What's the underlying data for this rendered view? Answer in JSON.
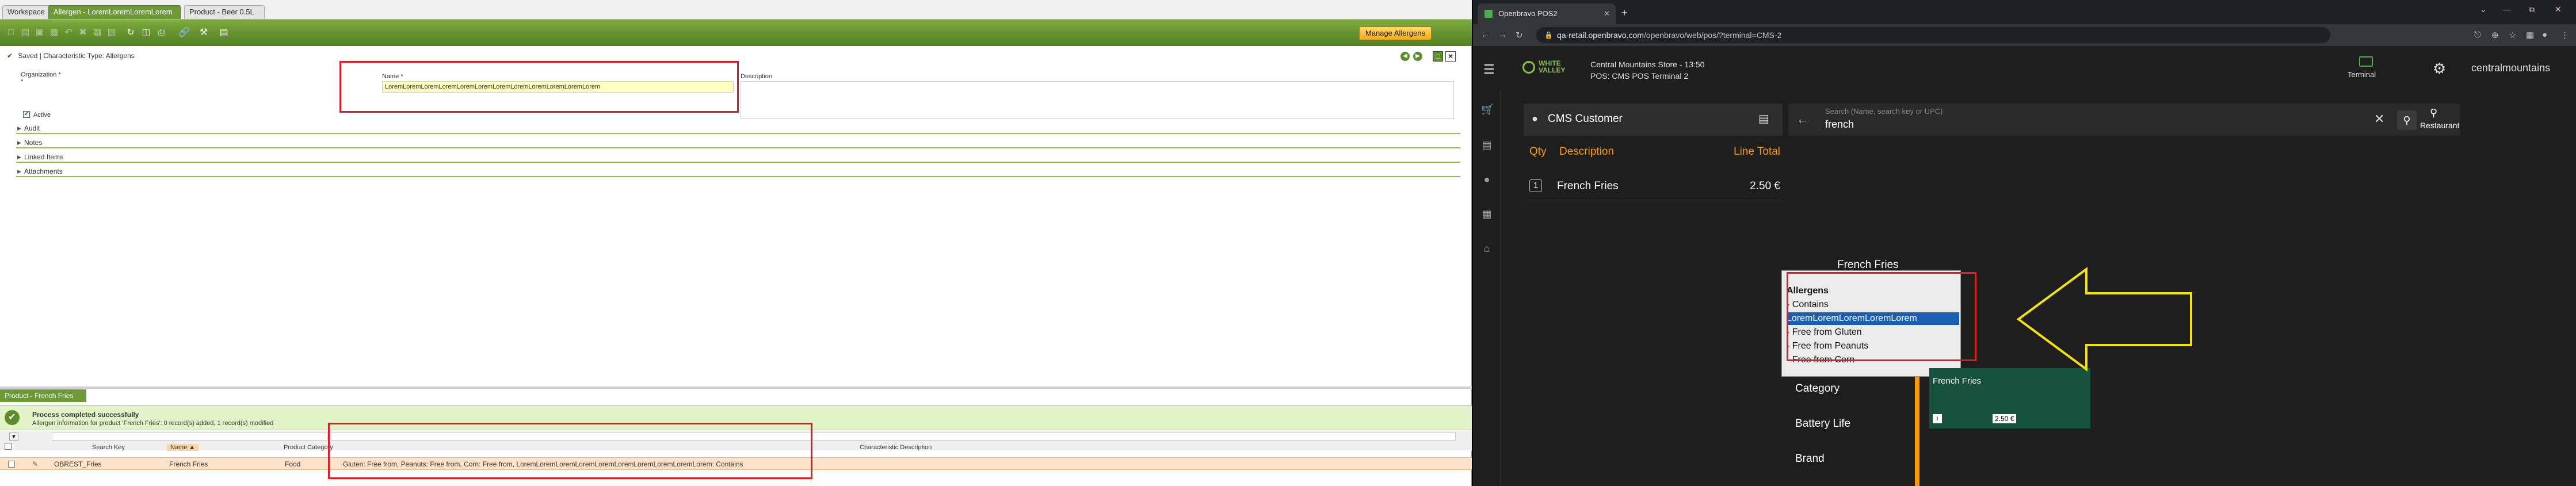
{
  "left": {
    "tabs": [
      {
        "label": "Workspace"
      },
      {
        "label": "Allergen - LoremLoremLoremLorem"
      },
      {
        "label": "Product - Beer 0.5L"
      }
    ],
    "manage_button": "Manage Allergens",
    "status": {
      "saved": "Saved",
      "separator": "|",
      "characteristic": "Characteristic Type: Allergens"
    },
    "form": {
      "organization_label": "Organization *",
      "name_label": "Name *",
      "name_value": "LoremLoremLoremLoremLoremLoremLoremLoremLoremLoremLoremLorem",
      "description_label": "Description",
      "active_label": "Active"
    },
    "sections": [
      "Audit",
      "Notes",
      "Linked Items",
      "Attachments"
    ],
    "bottom_tab": "Product - French Fries",
    "process": {
      "title": "Process completed successfully",
      "message": "Allergen information for product 'French Fries': 0 record(s) added, 1 record(s) modified"
    },
    "grid": {
      "headers": [
        "Search Key",
        "Name ▲",
        "Product Category",
        "Characteristic Description"
      ],
      "row": {
        "search_key": "OBREST_Fries",
        "name": "French Fries",
        "category": "Food",
        "characteristic": "Gluten: Free from, Peanuts: Free from, Corn: Free from, LoremLoremLoremLoremLoremLoremLoremLoremLoremLorem: Contains"
      }
    }
  },
  "right": {
    "browser_tab": "Openbravo POS2",
    "url_host": "qa-retail.openbravo.com",
    "url_path": "/openbravo/web/pos/?terminal=CMS-2",
    "brand_line1": "WHITE",
    "brand_line2": "VALLEY",
    "store": "Central Mountains Store - 13:50",
    "pos": "POS: CMS POS Terminal 2",
    "terminal_label": "Terminal",
    "user": "centralmountains",
    "customer": "CMS Customer",
    "ticket_headers": {
      "qty": "Qty",
      "description": "Description",
      "total": "Line Total"
    },
    "line": {
      "qty": "1",
      "product": "French Fries",
      "total": "2.50 €"
    },
    "search_placeholder": "Search (Name, search key or UPC)",
    "search_value": "french",
    "restaurant_label": "Restaurant",
    "result_title": "French Fries",
    "dropdown": {
      "title": "Allergens",
      "options": [
        "- Contains",
        "LoremLoremLoremLoremLorem",
        "- Free from Gluten",
        "- Free from Peanuts",
        "- Free from Corn"
      ]
    },
    "categories": [
      "Category",
      "Battery Life",
      "Brand"
    ],
    "product_card": {
      "name": "French Fries",
      "price": "2.50 €"
    }
  }
}
